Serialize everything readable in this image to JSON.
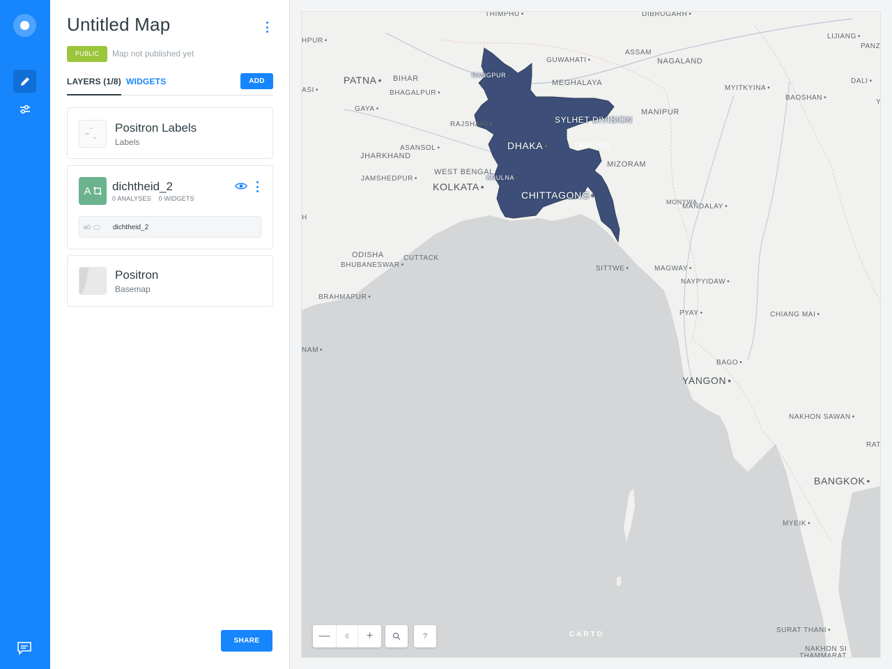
{
  "map": {
    "title": "Untitled Map",
    "privacy_badge": "PUBLIC",
    "publish_status": "Map not published yet"
  },
  "tabs": {
    "layers": "LAYERS (1/8)",
    "widgets": "WIDGETS",
    "add": "ADD"
  },
  "layers": [
    {
      "name": "Positron Labels",
      "type": "Labels"
    },
    {
      "name": "dichtheid_2",
      "letter": "A",
      "analyses": "0 ANALYSES",
      "widgets": "0 WIDGETS",
      "node_id": "a0",
      "node_name": "dichtheid_2"
    },
    {
      "name": "Positron",
      "type": "Basemap"
    }
  ],
  "share": "SHARE",
  "zoom": {
    "level": "6",
    "minus": "—",
    "plus": "+",
    "help": "?"
  },
  "attribution": "CARTO",
  "map_labels": {
    "thimphu": "THIMPHU",
    "dibrugarh": "DIBRUGARH",
    "lijiang": "LIJIANG",
    "panzi": "PANZI",
    "hpur": "HPUR",
    "assam": "ASSAM",
    "nagaland": "NAGALAND",
    "guwahati": "GUWAHATI",
    "dali": "DALI",
    "patna": "PATNA",
    "bihar": "BIHAR",
    "rangpur": "RANGPUR",
    "meghalaya": "MEGHALAYA",
    "myitkyina": "MYITKYINA",
    "asi": "ASI",
    "bhagalpur": "BHAGALPUR",
    "baoshan": "BAOSHAN",
    "y": "Y",
    "gaya": "GAYA",
    "manipur": "MANIPUR",
    "sylhet": "SYLHET DIVISION",
    "rajshahi": "RAJSHAHI",
    "asansol": "ASANSOL",
    "dhaka": "DHAKA",
    "tripura": "TRIPURA",
    "jharkhand": "JHARKHAND",
    "mizoram": "MIZORAM",
    "westbengal": "WEST BENGAL",
    "jamshedpur": "JAMSHEDPUR",
    "khulna": "KHULNA",
    "kolkata": "KOLKATA",
    "chittagong": "CHITTAGONG",
    "monywa": "MONYWA",
    "mandalay": "MANDALAY",
    "h": "H",
    "odisha": "ODISHA",
    "cuttack": "CUTTACK",
    "bhubaneswar": "BHUBANESWAR",
    "sittwe": "SITTWE",
    "magway": "MAGWAY",
    "naypyidaw": "NAYPYIDAW",
    "brahmapur": "BRAHMAPUR",
    "pyay": "PYAY",
    "chiangmai": "CHIANG MAI",
    "nam": "NAM",
    "bago": "BAGO",
    "yangon": "YANGON",
    "nakhonsawan": "NAKHON SAWAN",
    "rat": "RAT",
    "bangkok": "BANGKOK",
    "myeik": "MYEIK",
    "suratthani": "SURAT THANI",
    "nakhonsi": "NAKHON SI",
    "thammarat": "THAMMARAT"
  },
  "colors": {
    "rail": "#1785fb",
    "accent": "#1785fb",
    "public_badge": "#9bc63b",
    "analysis_node": "#6bb38d",
    "polygon_fill": "#3d4f78",
    "sea": "#d4d6d8",
    "land": "#f1f1ef"
  },
  "icons": {
    "logo": "carto-logo-icon",
    "edit": "pencil-icon",
    "settings": "sliders-icon",
    "chat": "chat-icon",
    "search": "search-icon",
    "visibility": "eye-icon"
  }
}
